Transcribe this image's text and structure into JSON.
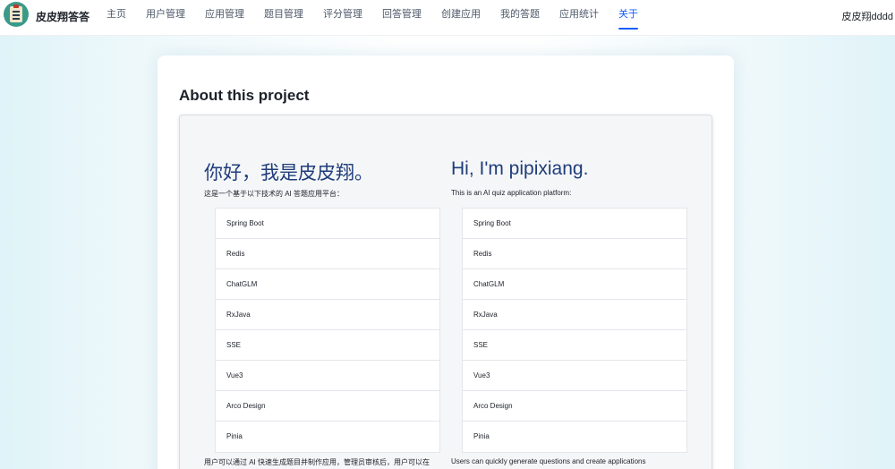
{
  "header": {
    "brand": "皮皮翔答答",
    "nav": [
      "主页",
      "用户管理",
      "应用管理",
      "题目管理",
      "评分管理",
      "回答管理",
      "创建应用",
      "我的答题",
      "应用统计",
      "关于"
    ],
    "active_nav": "关于",
    "user_name": "皮皮翔dddd"
  },
  "page": {
    "title": "About this project"
  },
  "left": {
    "heading": "你好，我是皮皮翔。",
    "subtitle": "这是一个基于以下技术的 AI 答题应用平台：",
    "techs": [
      "Spring Boot",
      "Redis",
      "ChatGLM",
      "RxJava",
      "SSE",
      "Vue3",
      "Arco Design",
      "Pinia"
    ],
    "description": "用户可以通过 AI 快速生成题目并制作应用，管理员审核后，用户可以在"
  },
  "right": {
    "heading": "Hi, I'm pipixiang.",
    "subtitle": "This is an AI quiz application platform:",
    "techs": [
      "Spring Boot",
      "Redis",
      "ChatGLM",
      "RxJava",
      "SSE",
      "Vue3",
      "Arco Design",
      "Pinia"
    ],
    "description": "Users can quickly generate questions and create applications"
  },
  "colors": {
    "accent": "#165dff",
    "heading": "#1f3d7a"
  }
}
